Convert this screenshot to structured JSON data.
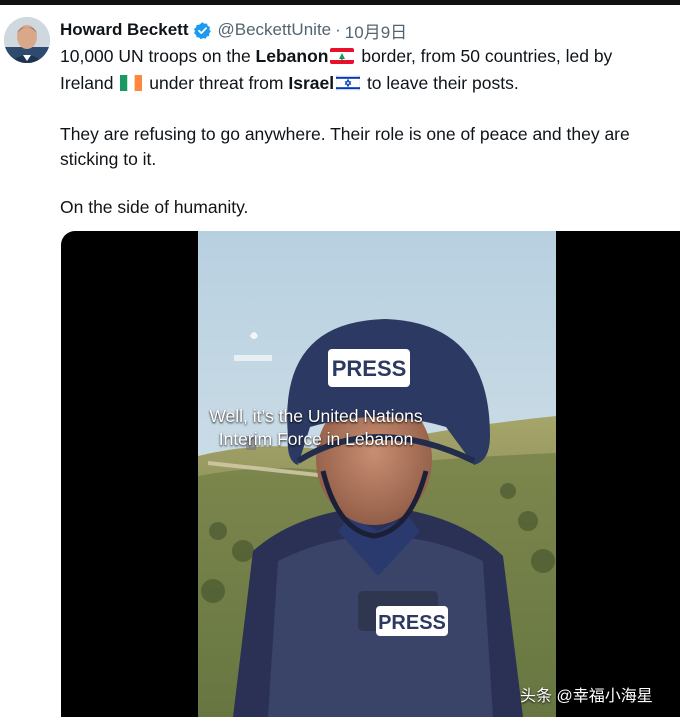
{
  "tweet": {
    "author_name": "Howard Beckett",
    "author_handle": "@BeckettUnite",
    "separator": "·",
    "date": "10月9日",
    "line1": {
      "pre": "10,000 UN troops on the ",
      "lebanon": "Lebanon",
      "mid": " border, from 50 countries, led by",
      "ireland_pre": "Ireland ",
      "ireland_post": " under threat from ",
      "israel": "Israel",
      "post": " to leave their posts."
    },
    "para2": "They are refusing to go anywhere. Their role is one of peace and they are sticking to it.",
    "para3": "On the side of humanity."
  },
  "video": {
    "helmet_text": "PRESS",
    "vest_text": "PRESS",
    "caption_line1": "Well, it’s the United Nations",
    "caption_line2": "Interim Force in Lebanon",
    "channel_logo": "aljazeera-logo"
  },
  "watermark": "头条 @幸福小海星",
  "colors": {
    "verified_blue": "#1d9bf0",
    "secondary_text": "#536471",
    "sky": "#c9dbe6",
    "hills": "#8c9a5c",
    "helmet": "#2c3a63"
  },
  "icons": [
    "verified-badge-icon",
    "lebanon-flag-icon",
    "ireland-flag-icon",
    "israel-flag-icon"
  ]
}
